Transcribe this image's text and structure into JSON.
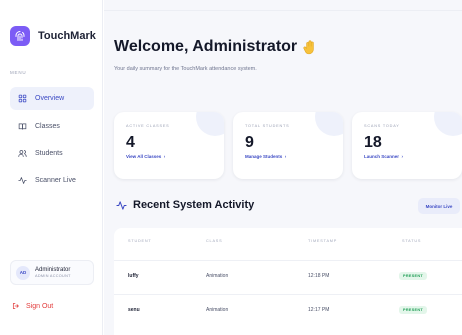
{
  "brand": {
    "name": "TouchMark"
  },
  "sidebar": {
    "menu_heading": "MENU",
    "items": [
      {
        "label": "Overview",
        "icon": "grid-icon",
        "active": true
      },
      {
        "label": "Classes",
        "icon": "book-icon",
        "active": false
      },
      {
        "label": "Students",
        "icon": "users-icon",
        "active": false
      },
      {
        "label": "Scanner Live",
        "icon": "pulse-icon",
        "active": false
      }
    ],
    "user": {
      "initials": "AD",
      "name": "Administrator",
      "role": "ADMIN ACCOUNT"
    },
    "signout_label": "Sign Out"
  },
  "header": {
    "title": "Welcome, Administrator",
    "subtitle": "Your daily summary for the TouchMark attendance system."
  },
  "stats": [
    {
      "label": "ACTIVE CLASSES",
      "value": "4",
      "link": "View All Classes"
    },
    {
      "label": "TOTAL STUDENTS",
      "value": "9",
      "link": "Manage Students"
    },
    {
      "label": "SCANS TODAY",
      "value": "18",
      "link": "Launch Scanner"
    }
  ],
  "activity": {
    "title": "Recent System Activity",
    "monitor_label": "Monitor Live",
    "columns": [
      "STUDENT",
      "CLASS",
      "TIMESTAMP",
      "STATUS"
    ],
    "rows": [
      {
        "student": "luffy",
        "class": "Animation",
        "timestamp": "12:18 PM",
        "status": "PRESENT"
      },
      {
        "student": "senu",
        "class": "Animation",
        "timestamp": "12:17 PM",
        "status": "PRESENT"
      }
    ]
  },
  "colors": {
    "accent": "#3b49c4",
    "brand": "#7c5cf5",
    "danger": "#e23b3b",
    "success": "#1f9d55"
  }
}
